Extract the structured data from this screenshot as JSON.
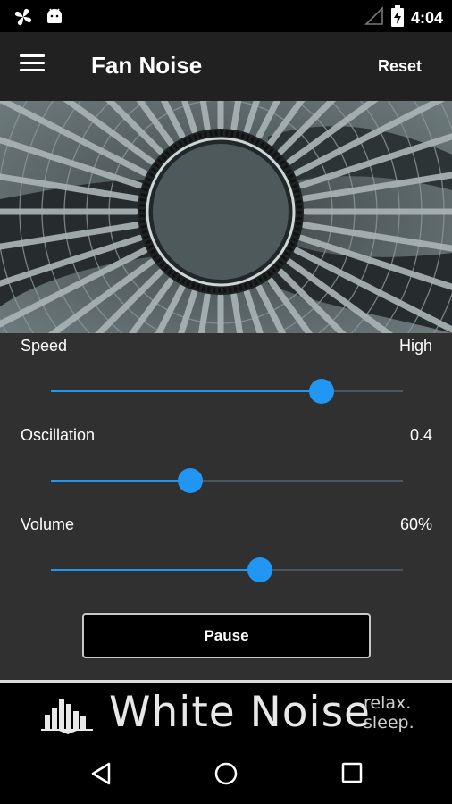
{
  "status_bar": {
    "time": "4:04",
    "left_icons": [
      "pinwheel-icon",
      "android-icon"
    ],
    "right_icons": [
      "signal-icon",
      "battery-charging-icon"
    ]
  },
  "toolbar": {
    "menu_icon": "hamburger-menu-icon",
    "title": "Fan Noise",
    "reset_label": "Reset"
  },
  "controls": {
    "speed": {
      "label": "Speed",
      "value": "High",
      "level": 0.77
    },
    "oscillation": {
      "label": "Oscillation",
      "value": "0.4",
      "level": 0.397
    },
    "volume": {
      "label": "Volume",
      "value": "60%",
      "level": 0.594
    }
  },
  "pause_label": "Pause",
  "banner": {
    "title": "White Noise",
    "tagline_line1": "relax.",
    "tagline_line2": "sleep."
  },
  "nav_bar": {
    "icons": [
      "back-icon",
      "home-icon",
      "recents-icon"
    ]
  },
  "colors": {
    "accent": "#2196f3",
    "toolbar": "#212121",
    "background": "#303030"
  }
}
